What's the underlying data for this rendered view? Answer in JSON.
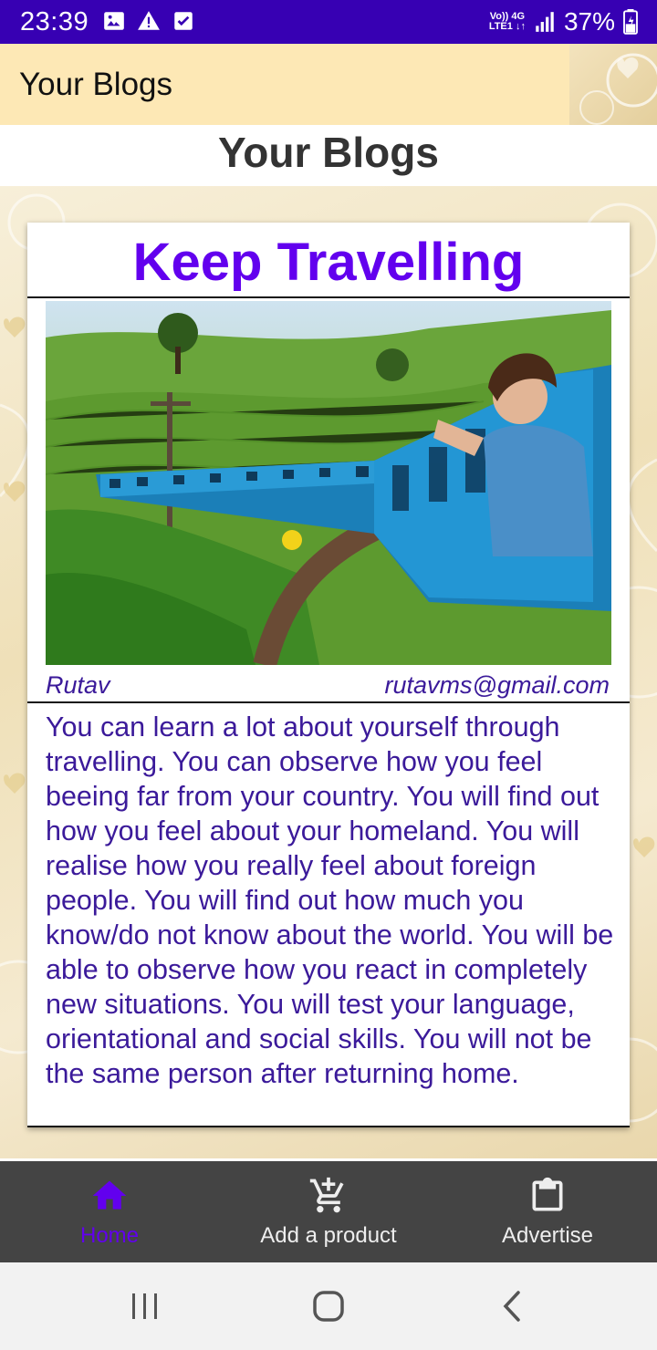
{
  "status_bar": {
    "time": "23:39",
    "network_top": "Vo)) 4G",
    "network_bottom": "LTE1 ↓↑",
    "battery": "37%",
    "icons": [
      "image-icon",
      "warning-icon",
      "checkbox-icon",
      "signal-icon",
      "battery-icon"
    ]
  },
  "app_bar": {
    "title": "Your Blogs"
  },
  "page": {
    "heading": "Your Blogs"
  },
  "blog": {
    "title": "Keep Travelling",
    "author": "Rutav",
    "email": "rutavms@gmail.com",
    "body": "You can learn a lot about yourself through travelling. You can observe how you feel beeing far from your country. You will find out how you feel about your homeland. You will realise how you really feel about foreign people. You will find out how much you know/do not know about the world. You will be able to observe how you react in completely new situations. You will test your language, orientational and social skills. You will not be the same person after returning home."
  },
  "bottom_nav": {
    "items": [
      {
        "label": "Home",
        "icon": "home-icon",
        "active": true
      },
      {
        "label": "Add a product",
        "icon": "add-cart-icon",
        "active": false
      },
      {
        "label": "Advertise",
        "icon": "clipboard-icon",
        "active": false
      }
    ]
  },
  "colors": {
    "status_bar": "#3700b3",
    "accent": "#6200ee",
    "app_bar": "#fde8b5",
    "text_purple": "#3b1a9a",
    "nav_bg": "#444444"
  }
}
